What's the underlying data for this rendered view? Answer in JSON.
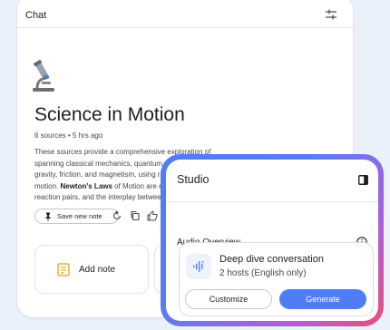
{
  "chat": {
    "title": "Chat",
    "notebook": {
      "title": "Science in Motion",
      "meta": "6 sources • 5 hrs ago",
      "summary_lines": [
        "These sources provide a comprehensive exploration of",
        "spanning classical mechanics, quantum physics,",
        "gravity, friction, and magnetism, using real",
        "motion.",
        "reaction pairs, and the interplay between"
      ],
      "summary_bold": "Newton's Laws",
      "summary_after_bold": " of Motion are ex"
    },
    "save_note_label": "Save new note",
    "add_note_label": "Add note"
  },
  "studio": {
    "title": "Studio",
    "audio_overview_label": "Audio Overview",
    "deep_dive": {
      "title": "Deep dive conversation",
      "subtitle": "2 hosts (English only)"
    },
    "customize_label": "Customize",
    "generate_label": "Generate"
  },
  "colors": {
    "accent": "#4f7df5",
    "gradient": [
      "#4f7df5",
      "#b05fd6",
      "#ea4f7a"
    ],
    "note_icon": "#f0a92f",
    "background": "#eaf1fb"
  },
  "icons": [
    "tune-icon",
    "microscope-icon",
    "pin-icon",
    "refresh-icon",
    "copy-icon",
    "thumbs-up-icon",
    "note-icon",
    "audio-wave-icon",
    "panel-icon",
    "info-icon"
  ]
}
